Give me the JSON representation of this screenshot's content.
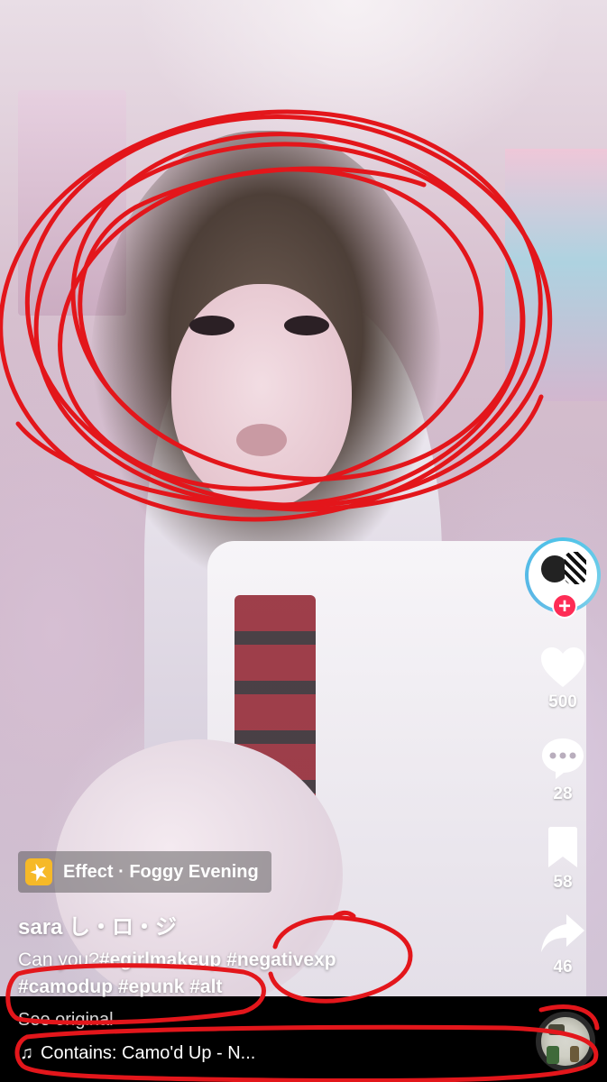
{
  "video": {
    "description_icon": "effect-sparkle-icon"
  },
  "effect": {
    "label": "Effect · Foggy Evening",
    "icon": "sparkle-icon",
    "icon_color": "#f6b928"
  },
  "author": {
    "username": "sara し・ロ・ジ"
  },
  "caption": {
    "lead": "Can you?",
    "tags_line1": [
      "#egirlmakeup",
      "#negativexp"
    ],
    "line1_sep": " ",
    "tags_line2": [
      "#camodup",
      "#epunk",
      "#alt"
    ],
    "see_original": "See original"
  },
  "rail": {
    "avatar_icon": "creator-avatar",
    "follow_label": "+",
    "follow_color": "#fe2c55",
    "likes": "500",
    "comments": "28",
    "saves": "58",
    "shares": "46"
  },
  "music": {
    "note_icon": "♫",
    "text": "Contains: Camo'd Up - N..."
  },
  "annotation_color": "#e3161b"
}
